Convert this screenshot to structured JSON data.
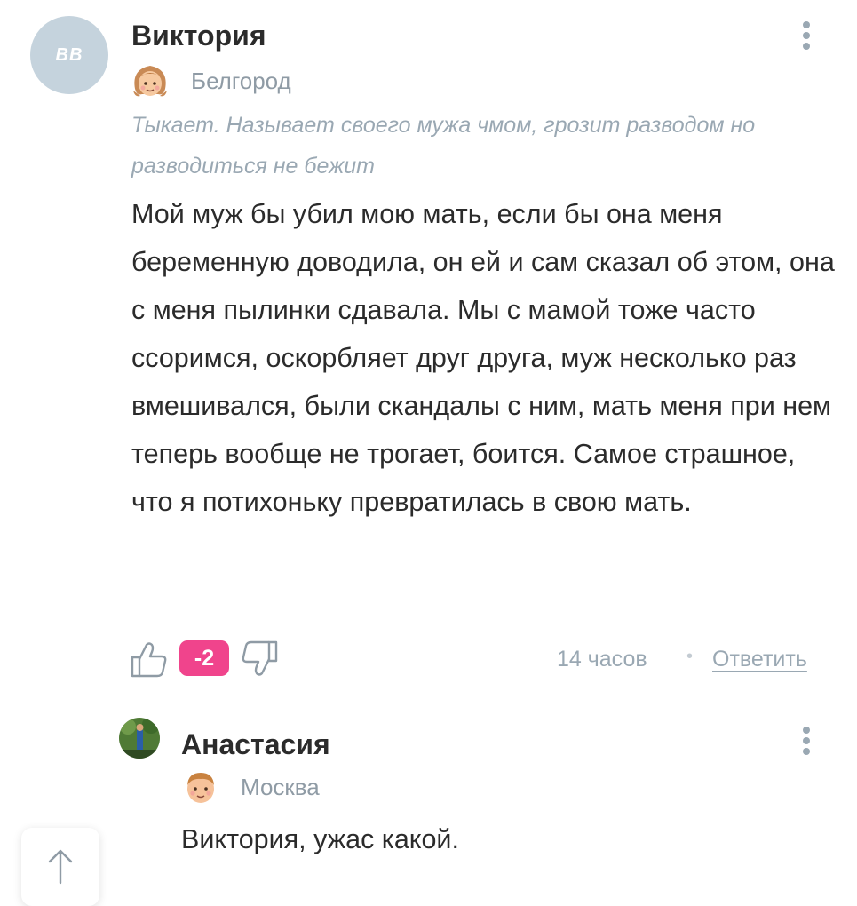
{
  "comment1": {
    "avatar_initials": "BB",
    "author": "Виктория",
    "city": "Белгород",
    "status": "Тыкает. Называет своего мужа чмом, грозит разводом но разводиться не бежит",
    "text": "Мой муж бы убил мою мать, если бы она меня беременную доводила, он ей и сам сказал об этом, она с меня пылинки сдавала. Мы с мамой тоже часто ссоримся, оскорбляет друг друга, муж несколько раз вмешивался, были скандалы с ним, мать меня при нем теперь вообще не трогает, боится. Самое страшное, что я потихоньку превратилась в свою мать.",
    "rating": "-2",
    "time": "14 часов",
    "separator": "•",
    "reply_label": "Ответить"
  },
  "comment2": {
    "author": "Анастасия",
    "city": "Москва",
    "text": "Виктория, ужас какой."
  },
  "colors": {
    "accent_rating": "#f0448c",
    "muted": "#9aa8b3",
    "avatar_bg": "#c5d3dd"
  },
  "icons": [
    "girl-emoji-icon",
    "boy-emoji-icon",
    "like-icon",
    "dislike-icon",
    "more-icon",
    "arrow-up-icon"
  ]
}
